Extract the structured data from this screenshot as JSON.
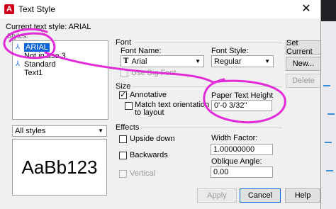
{
  "window": {
    "title": "Text Style",
    "close_glyph": "✕"
  },
  "current_style": {
    "label": "Current text style:",
    "value": "ARIAL"
  },
  "styles": {
    "label": "Styles:",
    "items": [
      {
        "label": "ARIAL",
        "icon": "annotative-icon"
      },
      {
        "label": "Not in use 3",
        "icon": ""
      },
      {
        "label": "Standard",
        "icon": "annotative-icon"
      },
      {
        "label": "Text1",
        "icon": ""
      }
    ],
    "filter": "All styles",
    "preview_text": "AaBb123"
  },
  "font": {
    "section": "Font",
    "name_label": "Font Name:",
    "name_value": "Arial",
    "style_label": "Font Style:",
    "style_value": "Regular",
    "big_font_label": "Use Big Font"
  },
  "size": {
    "section": "Size",
    "annotative_label": "Annotative",
    "annotative_checked": true,
    "match_label_line1": "Match text orientation",
    "match_label_line2": "to layout",
    "paper_height_label": "Paper Text Height",
    "paper_height_value": "0'-0 3/32\""
  },
  "effects": {
    "section": "Effects",
    "upside_down_label": "Upside down",
    "backwards_label": "Backwards",
    "vertical_label": "Vertical",
    "width_factor_label": "Width Factor:",
    "width_factor_value": "1.00000000",
    "oblique_label": "Oblique Angle:",
    "oblique_value": "0.00"
  },
  "buttons": {
    "set_current": "Set Current",
    "new": "New...",
    "delete": "Delete",
    "apply": "Apply",
    "cancel": "Cancel",
    "help": "Help"
  },
  "colors": {
    "annotation": "#e22bd8",
    "selection": "#0a64d8"
  }
}
